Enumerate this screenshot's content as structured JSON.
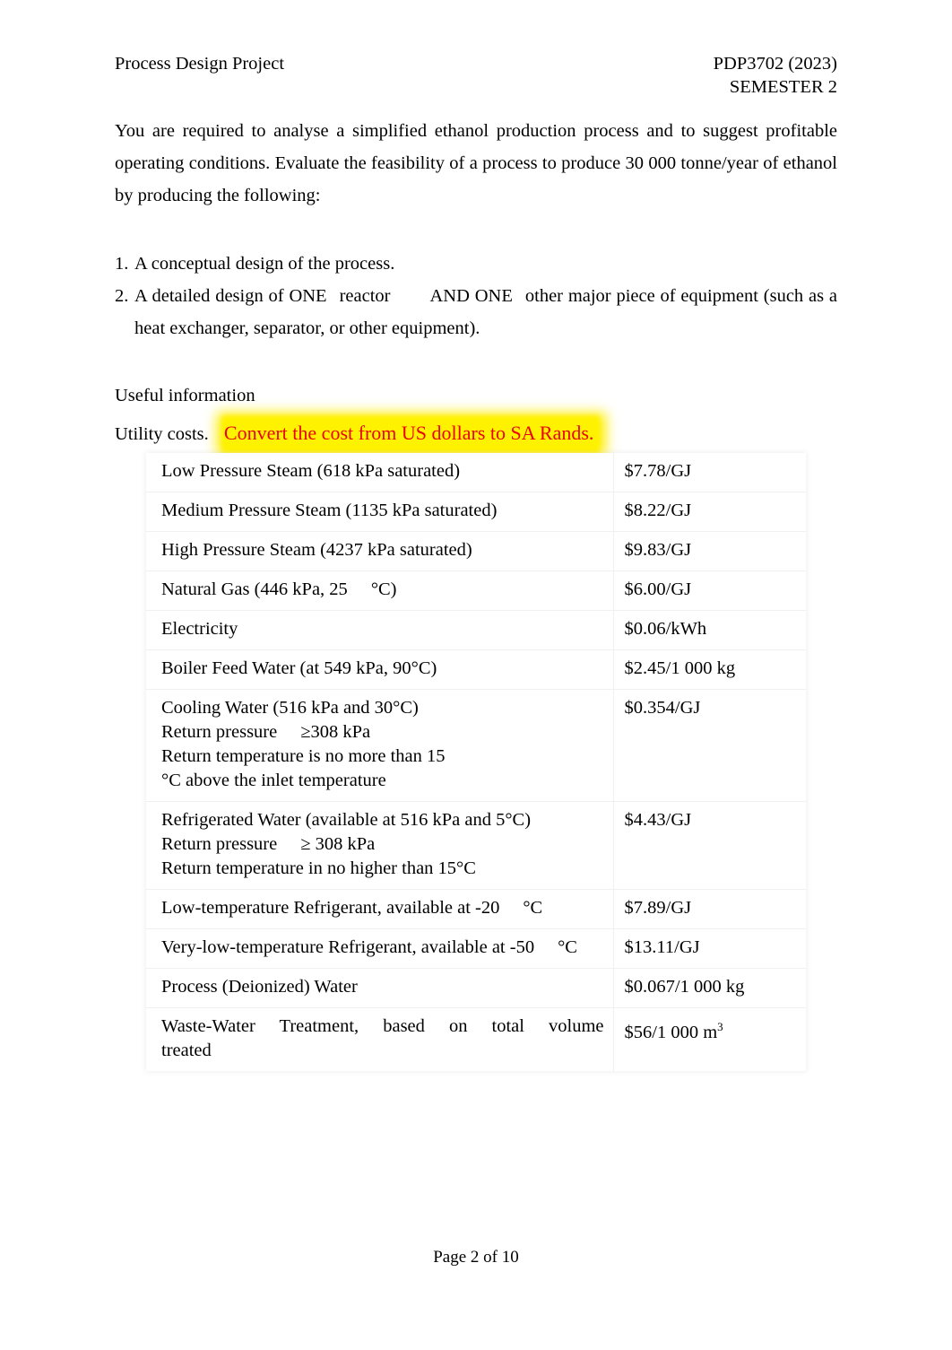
{
  "header": {
    "left": "Process Design Project",
    "right_line1": "PDP3702 (2023)",
    "right_line2": "SEMESTER 2"
  },
  "intro": "You are required to analyse a simplified ethanol production process and to suggest profitable operating conditions. Evaluate the feasibility of a process to produce 30 000 tonne/year of ethanol by producing the following:",
  "list": {
    "item1_num": "1.",
    "item1_text": "A conceptual design of the process.",
    "item2_num": "2.",
    "item2_part1": "A detailed design of ONE",
    "item2_part2": "reactor",
    "item2_part3": "AND ONE",
    "item2_part4": "other major piece of equipment (such as a heat exchanger, separator, or other equipment)."
  },
  "useful_information_label": "Useful information",
  "utility_costs_label": "Utility costs.",
  "annotation": {
    "text": "Convert the cost from US dollars to SA Rands.",
    "text_color": "#e8050a",
    "highlight_color": "#fff200"
  },
  "table": {
    "rows": [
      {
        "item": "Low Pressure Steam (618 kPa saturated)",
        "price": "$7.78/GJ"
      },
      {
        "item": "Medium Pressure Steam (1135 kPa saturated)",
        "price": "$8.22/GJ"
      },
      {
        "item": "High Pressure Steam (4237 kPa saturated)",
        "price": "$9.83/GJ"
      },
      {
        "item": "Natural Gas (446 kPa, 25",
        "item_tail": "°C)",
        "price": "$6.00/GJ"
      },
      {
        "item": "Electricity",
        "price": "$0.06/kWh"
      },
      {
        "item": "Boiler Feed Water (at 549 kPa, 90°C)",
        "price": "$2.45/1 000 kg"
      }
    ],
    "cooling_water": {
      "line1": "Cooling Water (516 kPa and 30°C)",
      "line2a": "Return pressure",
      "line2b": "≥308 kPa",
      "line3": "Return temperature is no more than 15",
      "line3b": "°C above the inlet temperature",
      "price": "$0.354/GJ"
    },
    "refrigerated_water": {
      "line1": "Refrigerated Water (available at 516 kPa and 5°C)",
      "line2a": "Return pressure",
      "line2b": "≥ 308 kPa",
      "line3": "Return temperature in no higher than 15°C",
      "price": "$4.43/GJ"
    },
    "rows_tail": [
      {
        "item": "Low-temperature Refrigerant, available at -20",
        "item_tail": "°C",
        "price": "$7.89/GJ"
      },
      {
        "item": "Very-low-temperature Refrigerant, available at -50",
        "item_tail": "°C",
        "price": "$13.11/GJ"
      },
      {
        "item": "Process (Deionized) Water",
        "price": "$0.067/1 000 kg"
      }
    ],
    "waste_water": {
      "line1": "Waste-Water Treatment, based on total volume",
      "line2": "treated",
      "price": "$56/1 000 m",
      "price_sup": "3"
    }
  },
  "footer": "Page 2 of 10"
}
